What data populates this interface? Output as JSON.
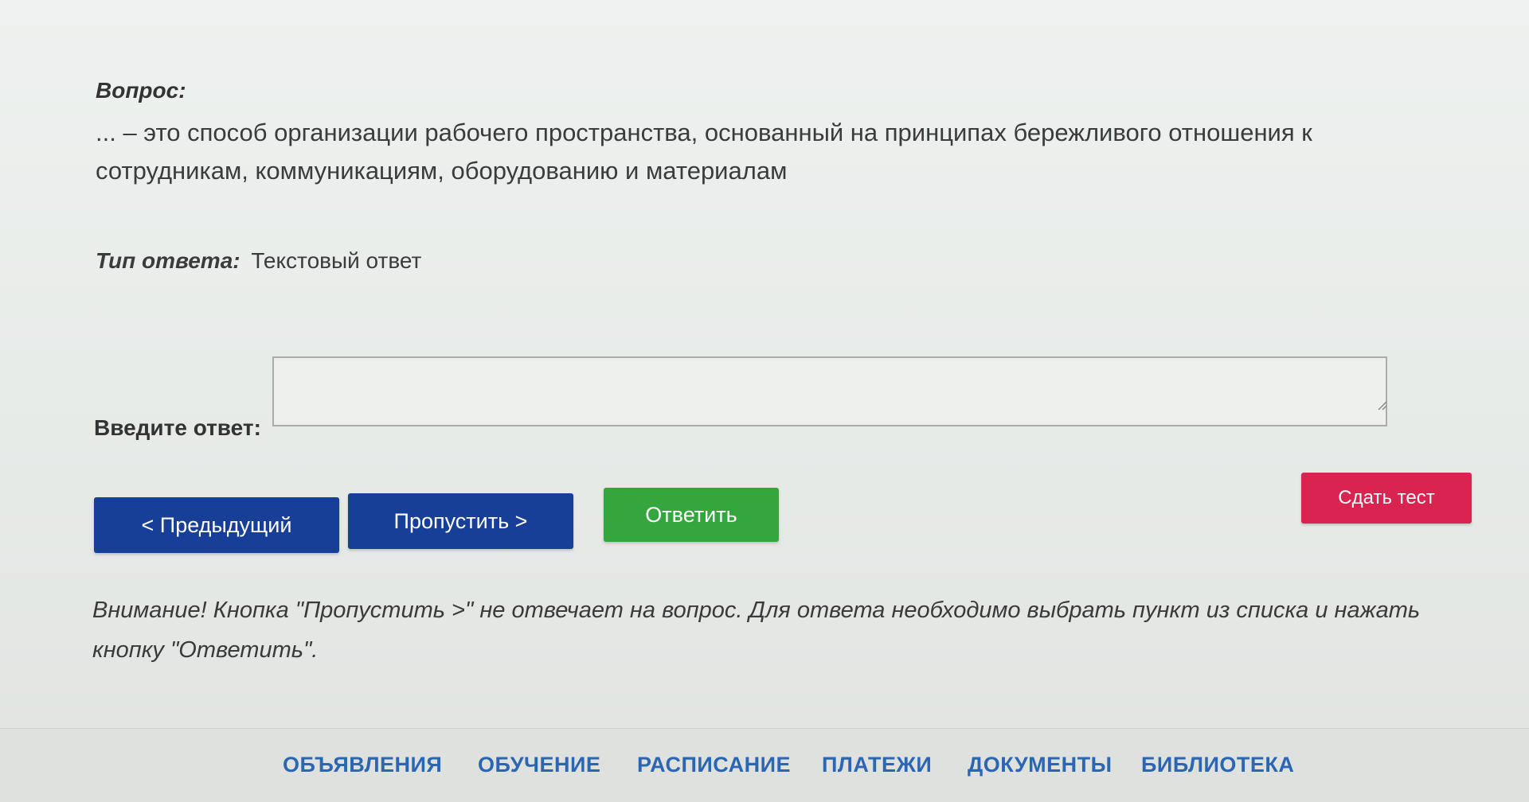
{
  "question": {
    "heading": "Вопрос:",
    "text": "... – это способ организации рабочего пространства, основанный на принципах бережливого отношения к сотрудникам, коммуникациям, оборудованию и материалам"
  },
  "answer_type": {
    "label": "Тип ответа:",
    "value": "Текстовый ответ"
  },
  "answer_input": {
    "label": "Введите ответ:",
    "value": "",
    "placeholder": ""
  },
  "buttons": {
    "previous": "< Предыдущий",
    "skip": "Пропустить >",
    "answer": "Ответить",
    "submit_test": "Сдать тест"
  },
  "warning": "Внимание! Кнопка \"Пропустить >\" не отвечает на вопрос. Для ответа необходимо выбрать пункт из списка и нажать кнопку \"Ответить\".",
  "nav": {
    "items": [
      {
        "label": "ОБЪЯВЛЕНИЯ"
      },
      {
        "label": "ОБУЧЕНИЕ"
      },
      {
        "label": "РАСПИСАНИЕ"
      },
      {
        "label": "ПЛАТЕЖИ"
      },
      {
        "label": "ДОКУМЕНТЫ"
      },
      {
        "label": "БИБЛИОТЕКА"
      }
    ]
  },
  "colors": {
    "primary_blue": "#183f97",
    "success_green": "#35a53e",
    "danger_red": "#d92350",
    "nav_link": "#2b66b3"
  }
}
